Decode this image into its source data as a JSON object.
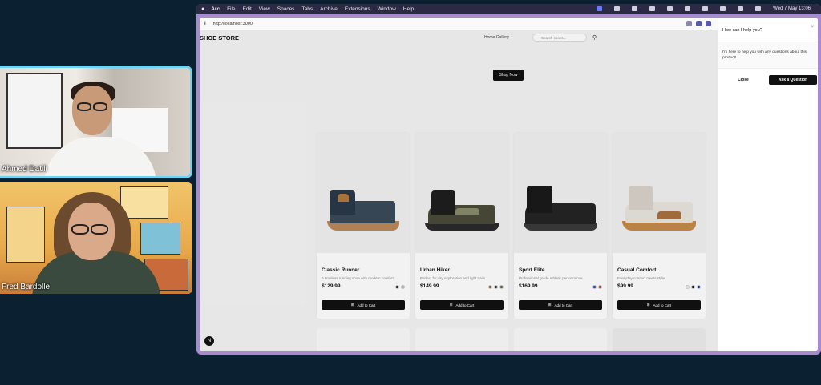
{
  "call": {
    "participants": [
      {
        "name": "Ahmed Datili"
      },
      {
        "name": "Fred Bardolle"
      }
    ]
  },
  "menubar": {
    "app": "Arc",
    "items": [
      "File",
      "Edit",
      "View",
      "Spaces",
      "Tabs",
      "Archive",
      "Extensions",
      "Window",
      "Help"
    ],
    "clock": "Wed 7 May 13:06"
  },
  "browser": {
    "url": "http://localhost:3000"
  },
  "site": {
    "logo": "SHOE STORE",
    "nav_link": "Home Gallery",
    "search_placeholder": "Search shoes...",
    "hero_button": "Shop Now",
    "add_to_cart": "Add to Cart",
    "products": [
      {
        "name": "Classic Runner",
        "desc": "A timeless running shoe with modern comfort",
        "price": "$129.99",
        "swatches": [
          "#111111",
          "#bbbbbb"
        ]
      },
      {
        "name": "Urban Hiker",
        "desc": "Perfect for city exploration and light trails",
        "price": "$149.99",
        "swatches": [
          "#8b4a3a",
          "#222222",
          "#4a5a3a"
        ]
      },
      {
        "name": "Sport Elite",
        "desc": "Professional grade athletic performance",
        "price": "$169.99",
        "swatches": [
          "#1a3a9a",
          "#c02a2a"
        ]
      },
      {
        "name": "Casual Comfort",
        "desc": "Everyday comfort meets style",
        "price": "$99.99",
        "swatches": [
          "#f2f2f2",
          "#111111",
          "#1a2a7a"
        ]
      }
    ]
  },
  "chat": {
    "title": "How can I help you?",
    "message": "I'm here to help you with any questions about this product!",
    "close_label": "Close",
    "ask_label": "Ask a Question"
  }
}
